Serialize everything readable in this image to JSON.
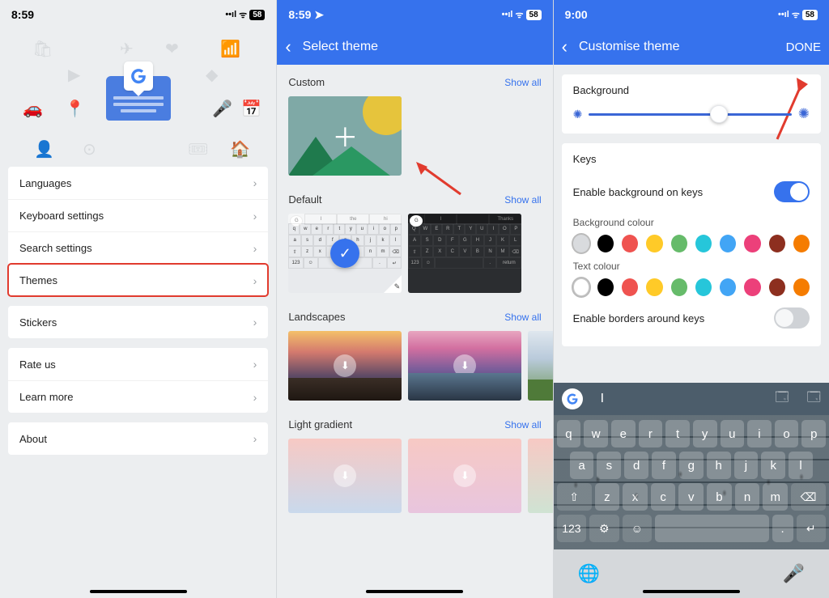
{
  "status1": {
    "time": "8:59",
    "battery": "58"
  },
  "status2": {
    "time": "8:59",
    "battery": "58"
  },
  "status3": {
    "time": "9:00",
    "battery": "58"
  },
  "panel1": {
    "menu_group1": [
      "Languages",
      "Keyboard settings",
      "Search settings",
      "Themes"
    ],
    "menu_group2": [
      "Stickers"
    ],
    "menu_group3": [
      "Rate us",
      "Learn more"
    ],
    "menu_group4": [
      "About"
    ]
  },
  "panel2": {
    "title": "Select theme",
    "sections": {
      "custom": {
        "title": "Custom",
        "show_all": "Show all"
      },
      "default": {
        "title": "Default",
        "show_all": "Show all"
      },
      "landscapes": {
        "title": "Landscapes",
        "show_all": "Show all"
      },
      "light_gradient": {
        "title": "Light gradient",
        "show_all": "Show all"
      }
    },
    "light_suggest": [
      "I",
      "the",
      "hi"
    ],
    "dark_suggest": [
      "I",
      "",
      "Thanks"
    ],
    "light_qwerty": [
      "q",
      "w",
      "e",
      "r",
      "t",
      "y",
      "u",
      "i",
      "o",
      "p"
    ],
    "dark_qwerty": [
      "Q",
      "W",
      "E",
      "R",
      "T",
      "Y",
      "U",
      "I",
      "O",
      "P"
    ]
  },
  "panel3": {
    "title": "Customise theme",
    "done": "DONE",
    "background": "Background",
    "keys_section": "Keys",
    "enable_bg": "Enable background on keys",
    "bg_colour": "Background colour",
    "text_colour": "Text colour",
    "enable_borders": "Enable borders around keys",
    "bg_swatches": [
      "#d9dbde",
      "#000000",
      "#ef5350",
      "#ffca28",
      "#66bb6a",
      "#26c6da",
      "#42a5f5",
      "#ec407a",
      "#8d2f1f",
      "#f57c00"
    ],
    "txt_swatches": [
      "#ffffff",
      "#000000",
      "#ef5350",
      "#ffca28",
      "#66bb6a",
      "#26c6da",
      "#42a5f5",
      "#ec407a",
      "#8d2f1f",
      "#f57c00"
    ],
    "kb": {
      "row1": [
        "q",
        "w",
        "e",
        "r",
        "t",
        "y",
        "u",
        "i",
        "o",
        "p"
      ],
      "row2": [
        "a",
        "s",
        "d",
        "f",
        "g",
        "h",
        "j",
        "k",
        "l"
      ],
      "row3": [
        "z",
        "x",
        "c",
        "v",
        "b",
        "n",
        "m"
      ],
      "shift": "⇧",
      "bksp": "⌫",
      "num": "123",
      "gear": "⚙",
      "emoji": "☺",
      "ret": "↵",
      "suggest": "I"
    }
  }
}
